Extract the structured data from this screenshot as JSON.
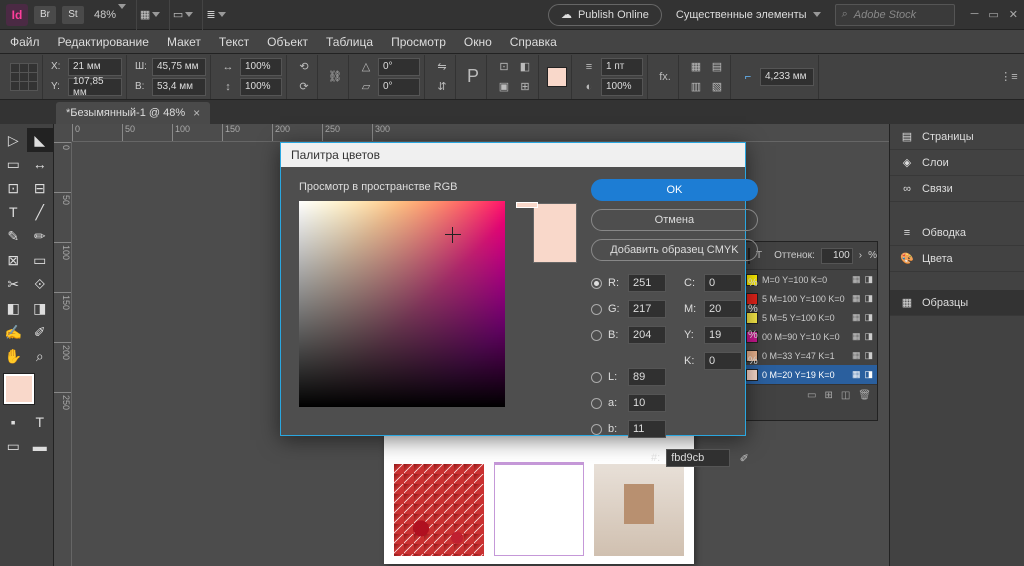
{
  "topbar": {
    "app": "Id",
    "br": "Br",
    "st": "St",
    "zoom": "48%",
    "publish": "Publish Online",
    "workspace": "Существенные элементы",
    "stock_placeholder": "Adobe Stock"
  },
  "menu": [
    "Файл",
    "Редактирование",
    "Макет",
    "Текст",
    "Объект",
    "Таблица",
    "Просмотр",
    "Окно",
    "Справка"
  ],
  "ctrl": {
    "x": "21 мм",
    "y": "107,85 мм",
    "w": "45,75 мм",
    "h": "53,4 мм",
    "scale1": "100%",
    "scale2": "100%",
    "angle": "0°",
    "shear": "0°",
    "stroke": "1 пт",
    "opacity": "100%",
    "para": "4,233 мм"
  },
  "tab": {
    "name": "*Безымянный-1 @ 48%"
  },
  "ruler_h": [
    "0",
    "50",
    "100",
    "150",
    "200",
    "250",
    "300"
  ],
  "ruler_v": [
    "0",
    "50",
    "100",
    "150",
    "200",
    "250"
  ],
  "panels": [
    {
      "icon": "pages",
      "label": "Страницы",
      "active": false
    },
    {
      "icon": "layers",
      "label": "Слои",
      "active": false
    },
    {
      "icon": "links",
      "label": "Связи",
      "active": false
    },
    {
      "icon": "stroke",
      "label": "Обводка",
      "active": false
    },
    {
      "icon": "color",
      "label": "Цвета",
      "active": false
    },
    {
      "icon": "swatches",
      "label": "Образцы",
      "active": true
    }
  ],
  "swatches": {
    "tint_label": "Оттенок:",
    "tint": "100",
    "list": [
      {
        "name": "M=0 Y=100 K=0",
        "c": "#ffef00"
      },
      {
        "name": "5 M=100 Y=100 K=0",
        "c": "#e2231a"
      },
      {
        "name": "5 M=5 Y=100 K=0",
        "c": "#f7e948"
      },
      {
        "name": "00 M=90 Y=10 K=0",
        "c": "#c6168d"
      },
      {
        "name": "0 M=33 Y=47 K=1",
        "c": "#e8b28d"
      },
      {
        "name": "0 M=20 Y=19 K=0",
        "c": "#f9d8ca",
        "sel": true
      }
    ]
  },
  "dialog": {
    "title": "Палитра цветов",
    "view": "Просмотр в пространстве RGB",
    "ok": "OK",
    "cancel": "Отмена",
    "add": "Добавить образец CMYK",
    "R": "251",
    "G": "217",
    "B": "204",
    "C": "0",
    "M": "20",
    "Y": "19",
    "K": "0",
    "L": "89",
    "a": "10",
    "b": "11",
    "hex": "fbd9cb"
  }
}
